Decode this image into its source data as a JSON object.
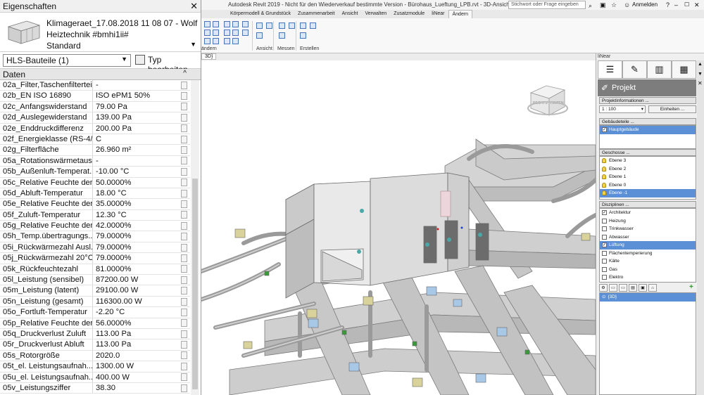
{
  "properties": {
    "panel_title": "Eigenschaften",
    "family_lines": [
      "Klimageraet_17.08.2018 11 08 07 - Wolf",
      "Heiztechnik #bmhi1ii#",
      "Standard"
    ],
    "category_filter": "HLS-Bauteile (1)",
    "edit_type_label": "Typ bearbeiten",
    "section_label": "Daten",
    "rows": [
      {
        "name": "02a_Filter,Taschenfilterteil",
        "value": "-"
      },
      {
        "name": "02b_EN ISO 16890",
        "value": "ISO ePM1 50%"
      },
      {
        "name": "02c_Anfangswiderstand",
        "value": "79.00 Pa"
      },
      {
        "name": "02d_Auslegewiderstand",
        "value": "139.00 Pa"
      },
      {
        "name": "02e_Enddruckdifferenz",
        "value": "200.00 Pa"
      },
      {
        "name": "02f_Energieklasse (RS-4/...",
        "value": "C"
      },
      {
        "name": "02g_Filterfläche",
        "value": "26.960 m²"
      },
      {
        "name": "05a_Rotationswärmetaus...",
        "value": "-"
      },
      {
        "name": "05b_Außenluft-Temperat...",
        "value": "-10.00 °C"
      },
      {
        "name": "05c_Relative Feuchte der ...",
        "value": "50.0000%"
      },
      {
        "name": "05d_Abluft-Temperatur",
        "value": "18.00 °C"
      },
      {
        "name": "05e_Relative Feuchte der ...",
        "value": "35.0000%"
      },
      {
        "name": "05f_Zuluft-Temperatur",
        "value": "12.30 °C"
      },
      {
        "name": "05g_Relative Feuchte der ...",
        "value": "42.0000%"
      },
      {
        "name": "05h_Temp.übertragungs...",
        "value": "79.0000%"
      },
      {
        "name": "05i_Rückwärmezahl Ausl...",
        "value": "79.0000%"
      },
      {
        "name": "05j_Rückwärmezahl 20°C...",
        "value": "79.0000%"
      },
      {
        "name": "05k_Rückfeuchtezahl",
        "value": "81.0000%"
      },
      {
        "name": "05l_Leistung (sensibel)",
        "value": "87200.00 W"
      },
      {
        "name": "05m_Leistung (latent)",
        "value": "29100.00 W"
      },
      {
        "name": "05n_Leistung (gesamt)",
        "value": "116300.00 W"
      },
      {
        "name": "05o_Fortluft-Temperatur",
        "value": "-2.20 °C"
      },
      {
        "name": "05p_Relative Feuchte der ...",
        "value": "56.0000%"
      },
      {
        "name": "05q_Druckverlust Zuluft",
        "value": "113.00 Pa"
      },
      {
        "name": "05r_Druckverlust Abluft",
        "value": "113.00 Pa"
      },
      {
        "name": "05s_Rotorgröße",
        "value": "2020.0"
      },
      {
        "name": "05t_el. Leistungsaufnah...",
        "value": "1300.00 W"
      },
      {
        "name": "05u_el. Leistungsaufnah...",
        "value": "400.00 W"
      },
      {
        "name": "05v_Leistungsziffer",
        "value": "38.30"
      }
    ]
  },
  "titlebar": {
    "title": "Autodesk Revit 2019 - Nicht für den Wiederverkauf bestimmte Version - Bürohaus_Lueftung_LPB.rvt - 3D-Ansicht: {3D}",
    "search_placeholder": "Stichwort oder Frage eingeben",
    "login_label": "Anmelden"
  },
  "ribbon": {
    "tabs": [
      "Körpermodell & Grundstück",
      "Zusammenarbeit",
      "Ansicht",
      "Verwalten",
      "Zusatzmodule",
      "liNear",
      "Ändern"
    ],
    "active_tab_index": 6,
    "panel_labels": [
      "ändern",
      "Ansicht",
      "Messen",
      "Erstellen"
    ]
  },
  "view": {
    "tab_label": "3D}",
    "viewcube_faces": [
      "RECHTS",
      "HINTEN"
    ]
  },
  "linear_panel": {
    "title": "liNear",
    "banner": "Projekt",
    "project_info_header": "Projektinformationen ...",
    "scale_value": "1 : 100",
    "units_button": "Einheiten ...",
    "building_header": "Gebäudeteile ...",
    "buildings": [
      {
        "label": "Hauptgebäude",
        "checked": true,
        "selected": true
      }
    ],
    "levels_header": "Geschosse ...",
    "levels": [
      {
        "label": "Ebene 3",
        "selected": false
      },
      {
        "label": "Ebene 2",
        "selected": false
      },
      {
        "label": "Ebene 1",
        "selected": false
      },
      {
        "label": "Ebene 0",
        "selected": false
      },
      {
        "label": "Ebene -1",
        "selected": true
      }
    ],
    "disciplines_header": "Disziplinen ...",
    "disciplines": [
      {
        "label": "Architektur",
        "checked": true,
        "selected": false
      },
      {
        "label": "Heizung",
        "checked": false,
        "selected": false
      },
      {
        "label": "Trinkwasser",
        "checked": false,
        "selected": false
      },
      {
        "label": "Abwasser",
        "checked": false,
        "selected": false
      },
      {
        "label": "Lüftung",
        "checked": true,
        "selected": true
      },
      {
        "label": "Flächentemperierung",
        "checked": false,
        "selected": false
      },
      {
        "label": "Kälte",
        "checked": false,
        "selected": false
      },
      {
        "label": "Gas",
        "checked": false,
        "selected": false
      },
      {
        "label": "Elektro",
        "checked": false,
        "selected": false
      }
    ],
    "view_items": [
      {
        "label": "{3D}",
        "selected": true
      }
    ],
    "accent_color": "#5b8fd6"
  }
}
